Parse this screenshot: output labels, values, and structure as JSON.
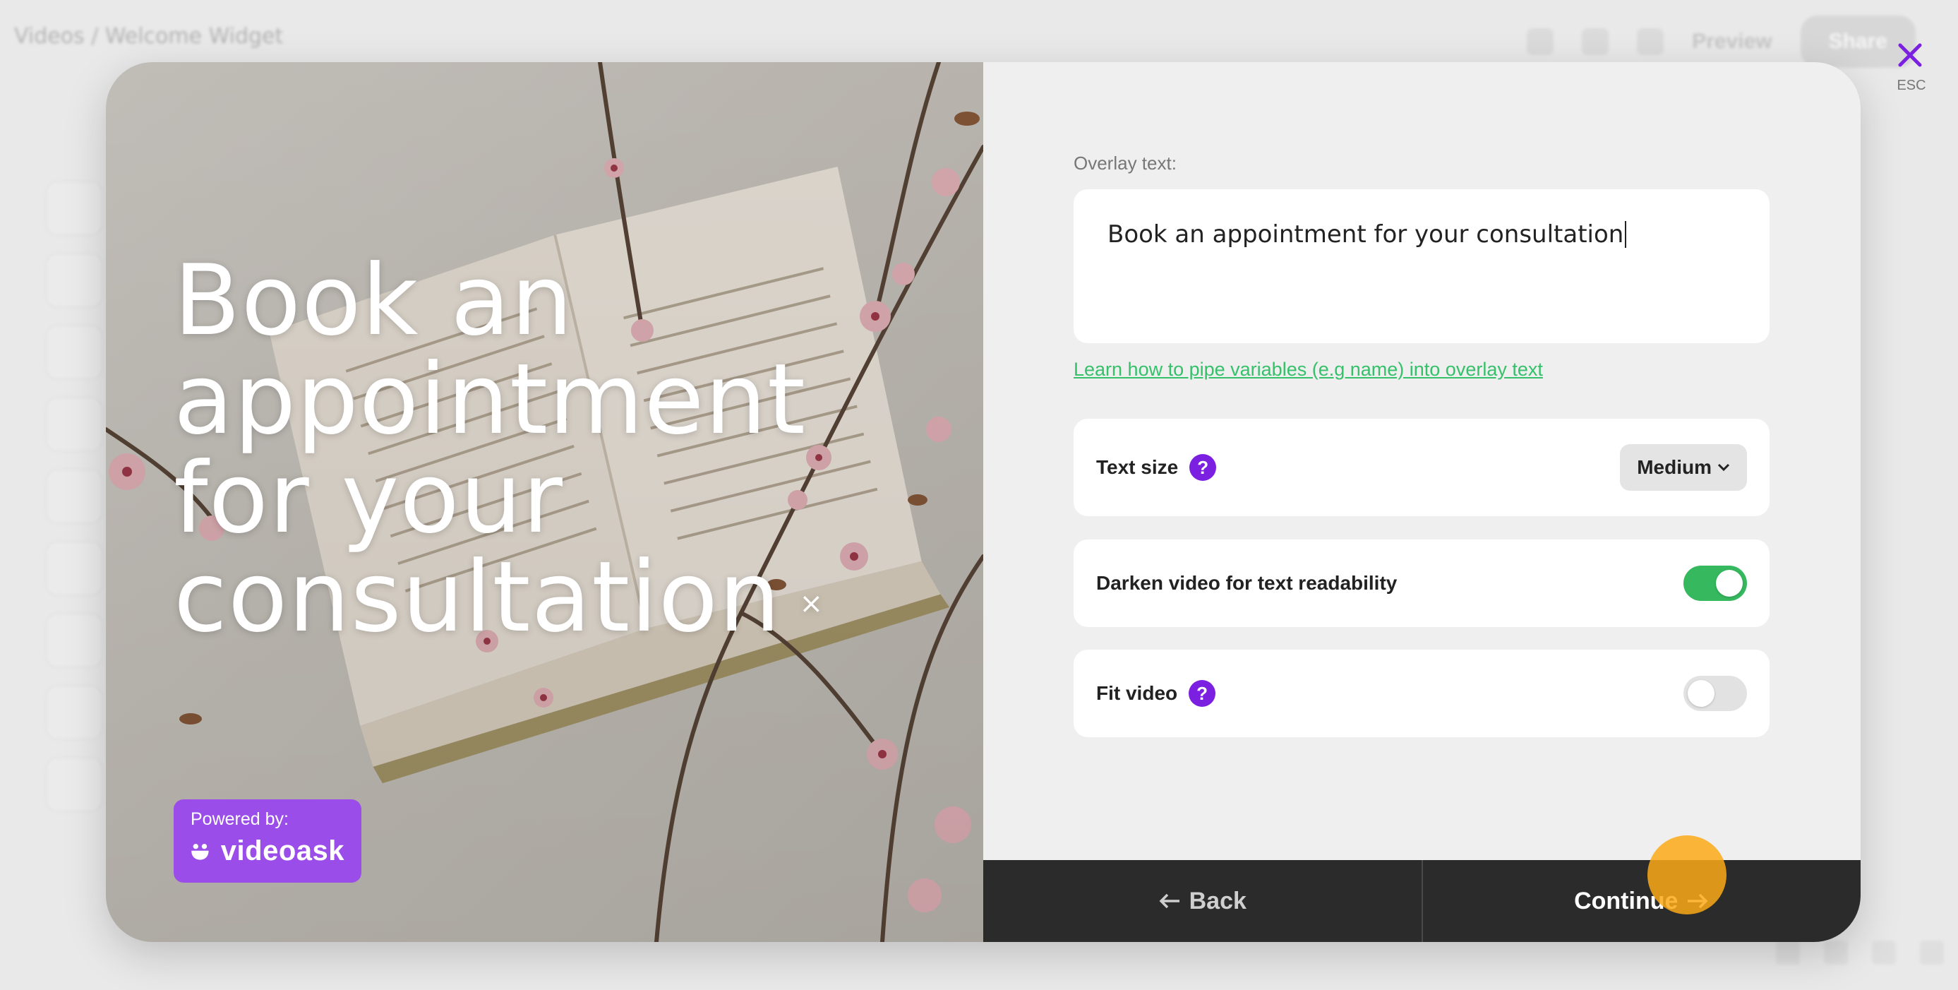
{
  "background": {
    "breadcrumb": "Videos / Welcome Widget",
    "preview_label": "Preview",
    "share_label": "Share"
  },
  "preview": {
    "overlay_text": "Book an appointment for your consultation",
    "overlay_close_symbol": "×",
    "powered_by": "Powered by:",
    "brand_name": "videoask"
  },
  "settings": {
    "overlay_label": "Overlay text:",
    "overlay_value": "Book an appointment for your consultation",
    "learn_link": "Learn how to pipe variables (e.g name) into overlay text",
    "text_size_label": "Text size",
    "text_size_value": "Medium",
    "darken_label": "Darken video for text readability",
    "darken_on": true,
    "fit_label": "Fit video",
    "fit_on": false,
    "help_symbol": "?"
  },
  "footer": {
    "back_label": "Back",
    "continue_label": "Continue"
  },
  "close": {
    "esc_label": "ESC"
  },
  "colors": {
    "accent_purple": "#7b1fe0",
    "brand_purple": "#9a4de8",
    "toggle_green": "#35b85e",
    "link_green": "#35c06a",
    "footer_dark": "#2b2b2b",
    "cursor_orange": "#fcaa18"
  }
}
